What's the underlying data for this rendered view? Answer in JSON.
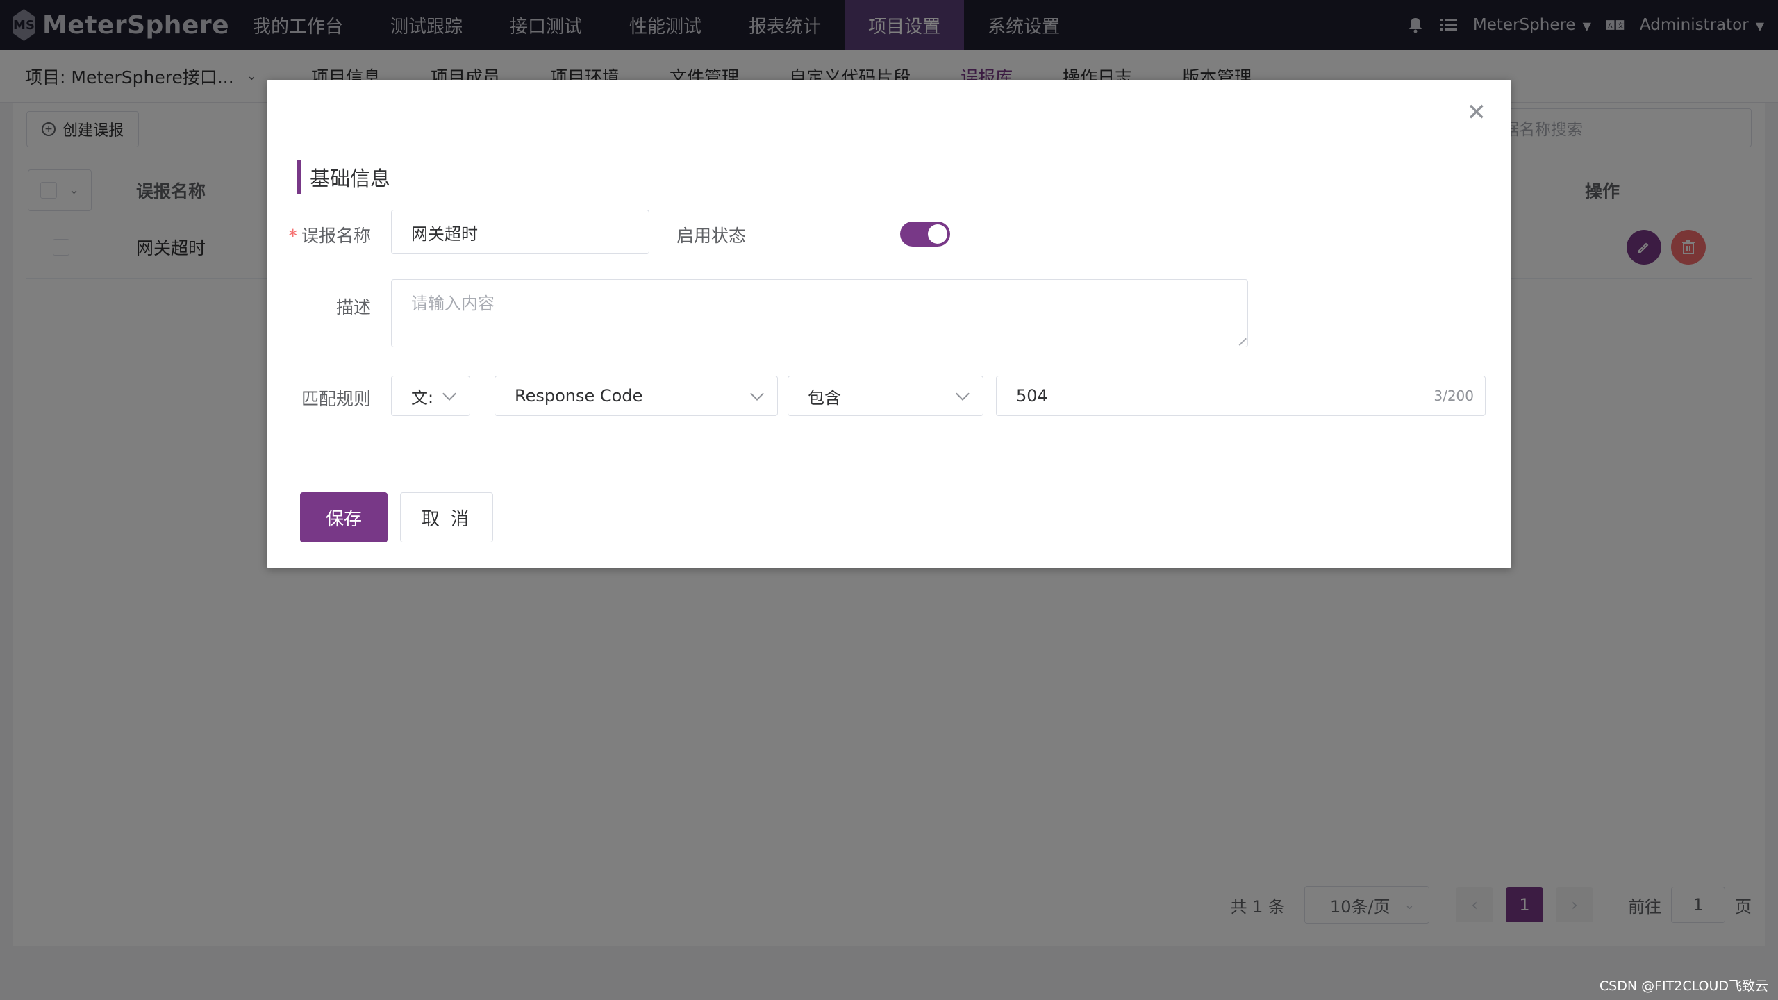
{
  "header": {
    "logo_text": "MeterSphere",
    "nav": [
      "我的工作台",
      "测试跟踪",
      "接口测试",
      "性能测试",
      "报表统计",
      "项目设置",
      "系统设置"
    ],
    "workspace": "MeterSphere",
    "user": "Administrator"
  },
  "subbar": {
    "project": "项目: MeterSphere接口...",
    "tabs": [
      "项目信息",
      "项目成员",
      "项目环境",
      "文件管理",
      "自定义代码片段",
      "误报库",
      "操作日志",
      "版本管理"
    ]
  },
  "content": {
    "create_label": "创建误报",
    "search_placeholder": "根据名称搜索",
    "column_name": "误报名称",
    "column_op": "操作",
    "rows": [
      {
        "name": "网关超时"
      }
    ],
    "pager": {
      "total": "共 1 条",
      "page_size": "10条/页",
      "current": "1",
      "goto_label": "前往",
      "goto_value": "1",
      "page_suffix": "页"
    }
  },
  "dialog": {
    "section_title": "基础信息",
    "name_label": "误报名称",
    "name_value": "网关超时",
    "status_label": "启用状态",
    "status_on": true,
    "desc_label": "描述",
    "desc_placeholder": "请输入内容",
    "rule_label": "匹配规则",
    "rule_type": "文:",
    "rule_field": "Response Code",
    "rule_op": "包含",
    "rule_value": "504",
    "rule_counter": "3/200",
    "save_label": "保存",
    "cancel_label": "取 消"
  },
  "watermark": "CSDN @FIT2CLOUD飞致云",
  "colors": {
    "primary": "#783887",
    "header_bg": "#1f1f2e",
    "danger": "#f56c6c"
  }
}
